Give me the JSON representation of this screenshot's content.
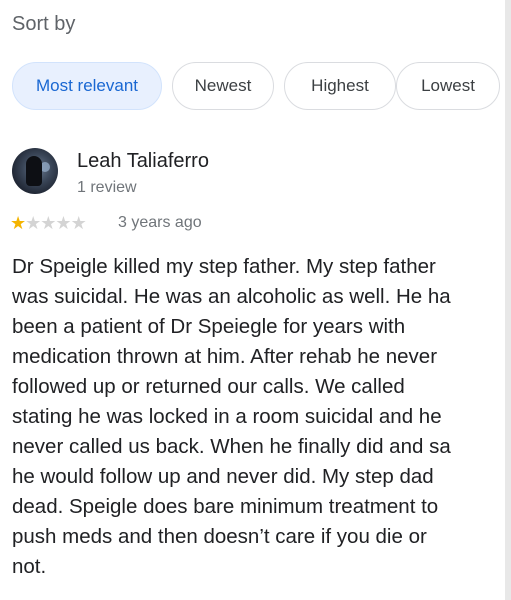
{
  "sort": {
    "label": "Sort by",
    "options": [
      "Most relevant",
      "Newest",
      "Highest",
      "Lowest"
    ],
    "selected": "Most relevant"
  },
  "review": {
    "author": "Leah Taliaferro",
    "review_count": "1 review",
    "rating": 1,
    "max_rating": 5,
    "time_ago": "3 years ago",
    "lines": [
      "Dr Speigle killed my step father. My step father",
      "was suicidal. He was an alcoholic as well. He ha",
      "been a patient of Dr Speiegle for years with",
      "medication thrown at him. After rehab he never",
      "followed up or returned our calls. We called",
      "stating he was locked in a room suicidal and he",
      "never called us back. When he finally did and sa",
      "he would follow up and never did.  My step dad",
      "dead. Speigle does bare minimum treatment to",
      "push meds and then doesn’t care if you die or",
      "not."
    ]
  },
  "colors": {
    "star_filled": "#f4b400",
    "star_empty": "#d4d4d4",
    "chip_active_bg": "#e8f0fe",
    "chip_active_text": "#1967d2"
  }
}
